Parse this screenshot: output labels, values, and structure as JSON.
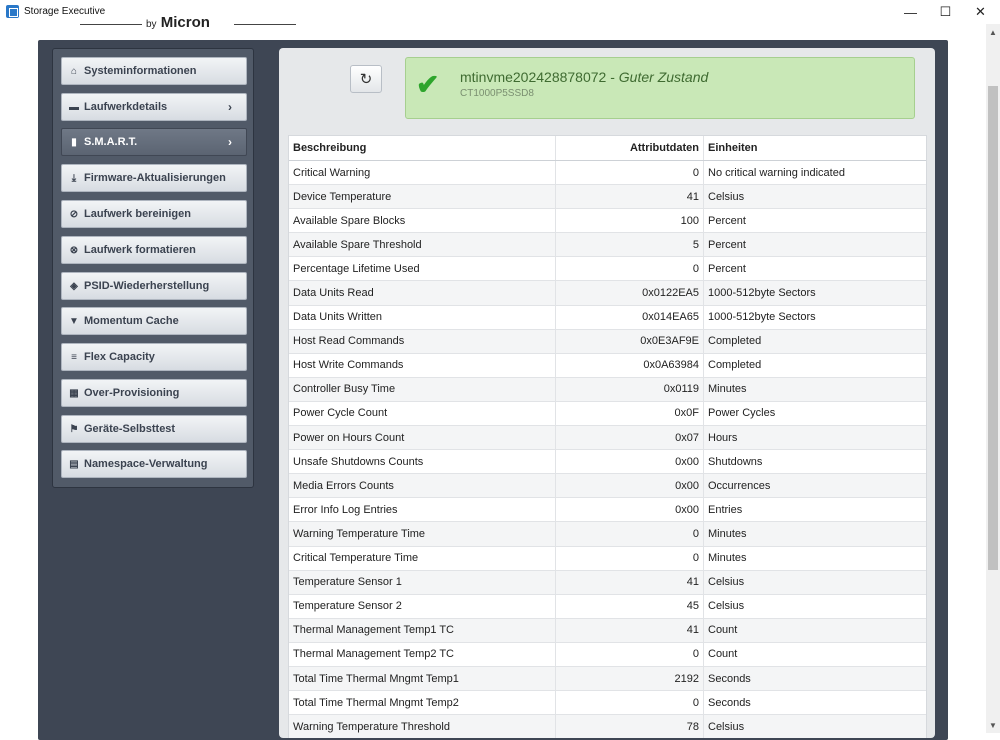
{
  "window": {
    "title": "Storage Executive",
    "minimize": "—",
    "maximize": "☐",
    "close": "✕"
  },
  "logo": {
    "by": "by",
    "brand": "Micron"
  },
  "sidebar": {
    "items": [
      {
        "label": "Systeminformationen",
        "icon": "home-icon",
        "glyph": "⌂"
      },
      {
        "label": "Laufwerkdetails",
        "icon": "drive-icon",
        "glyph": "▬",
        "chevron": "›"
      },
      {
        "label": "S.M.A.R.T.",
        "icon": "bar-chart-icon",
        "glyph": "▮",
        "chevron": "›",
        "active": true
      },
      {
        "label": "Firmware-Aktualisierungen",
        "icon": "download-icon",
        "glyph": "⤓"
      },
      {
        "label": "Laufwerk bereinigen",
        "icon": "no-entry-icon",
        "glyph": "⊘"
      },
      {
        "label": "Laufwerk formatieren",
        "icon": "format-icon",
        "glyph": "⊗"
      },
      {
        "label": "PSID-Wiederherstellung",
        "icon": "eye-slash-icon",
        "glyph": "◈"
      },
      {
        "label": "Momentum Cache",
        "icon": "filter-icon",
        "glyph": "▼"
      },
      {
        "label": "Flex Capacity",
        "icon": "list-icon",
        "glyph": "≡"
      },
      {
        "label": "Over-Provisioning",
        "icon": "grid-icon",
        "glyph": "▦"
      },
      {
        "label": "Geräte-Selbsttest",
        "icon": "flag-icon",
        "glyph": "⚑"
      },
      {
        "label": "Namespace-Verwaltung",
        "icon": "namespace-icon",
        "glyph": "▤"
      }
    ]
  },
  "status": {
    "drive": "mtinvme202428878072",
    "separator": " - ",
    "health": "Guter Zustand",
    "model": "CT1000P5SSD8",
    "check": "✔",
    "refresh": "↻"
  },
  "table": {
    "headers": [
      "Beschreibung",
      "Attributdaten",
      "Einheiten"
    ],
    "rows": [
      [
        "Critical Warning",
        "0",
        "No critical warning indicated"
      ],
      [
        "Device Temperature",
        "41",
        "Celsius"
      ],
      [
        "Available Spare Blocks",
        "100",
        "Percent"
      ],
      [
        "Available Spare Threshold",
        "5",
        "Percent"
      ],
      [
        "Percentage Lifetime Used",
        "0",
        "Percent"
      ],
      [
        "Data Units Read",
        "0x0122EA5",
        "1000-512byte Sectors"
      ],
      [
        "Data Units Written",
        "0x014EA65",
        "1000-512byte Sectors"
      ],
      [
        "Host Read Commands",
        "0x0E3AF9E",
        "Completed"
      ],
      [
        "Host Write Commands",
        "0x0A63984",
        "Completed"
      ],
      [
        "Controller Busy Time",
        "0x0119",
        "Minutes"
      ],
      [
        "Power Cycle Count",
        "0x0F",
        "Power Cycles"
      ],
      [
        "Power on Hours Count",
        "0x07",
        "Hours"
      ],
      [
        "Unsafe Shutdowns Counts",
        "0x00",
        "Shutdowns"
      ],
      [
        "Media Errors Counts",
        "0x00",
        "Occurrences"
      ],
      [
        "Error Info Log Entries",
        "0x00",
        "Entries"
      ],
      [
        "Warning Temperature Time",
        "0",
        "Minutes"
      ],
      [
        "Critical Temperature Time",
        "0",
        "Minutes"
      ],
      [
        "Temperature Sensor 1",
        "41",
        "Celsius"
      ],
      [
        "Temperature Sensor 2",
        "45",
        "Celsius"
      ],
      [
        "Thermal Management Temp1 TC",
        "41",
        "Count"
      ],
      [
        "Thermal Management Temp2 TC",
        "0",
        "Count"
      ],
      [
        "Total Time Thermal Mngmt Temp1",
        "2192",
        "Seconds"
      ],
      [
        "Total Time Thermal Mngmt Temp2",
        "0",
        "Seconds"
      ],
      [
        "Warning Temperature Threshold",
        "78",
        "Celsius"
      ]
    ]
  }
}
